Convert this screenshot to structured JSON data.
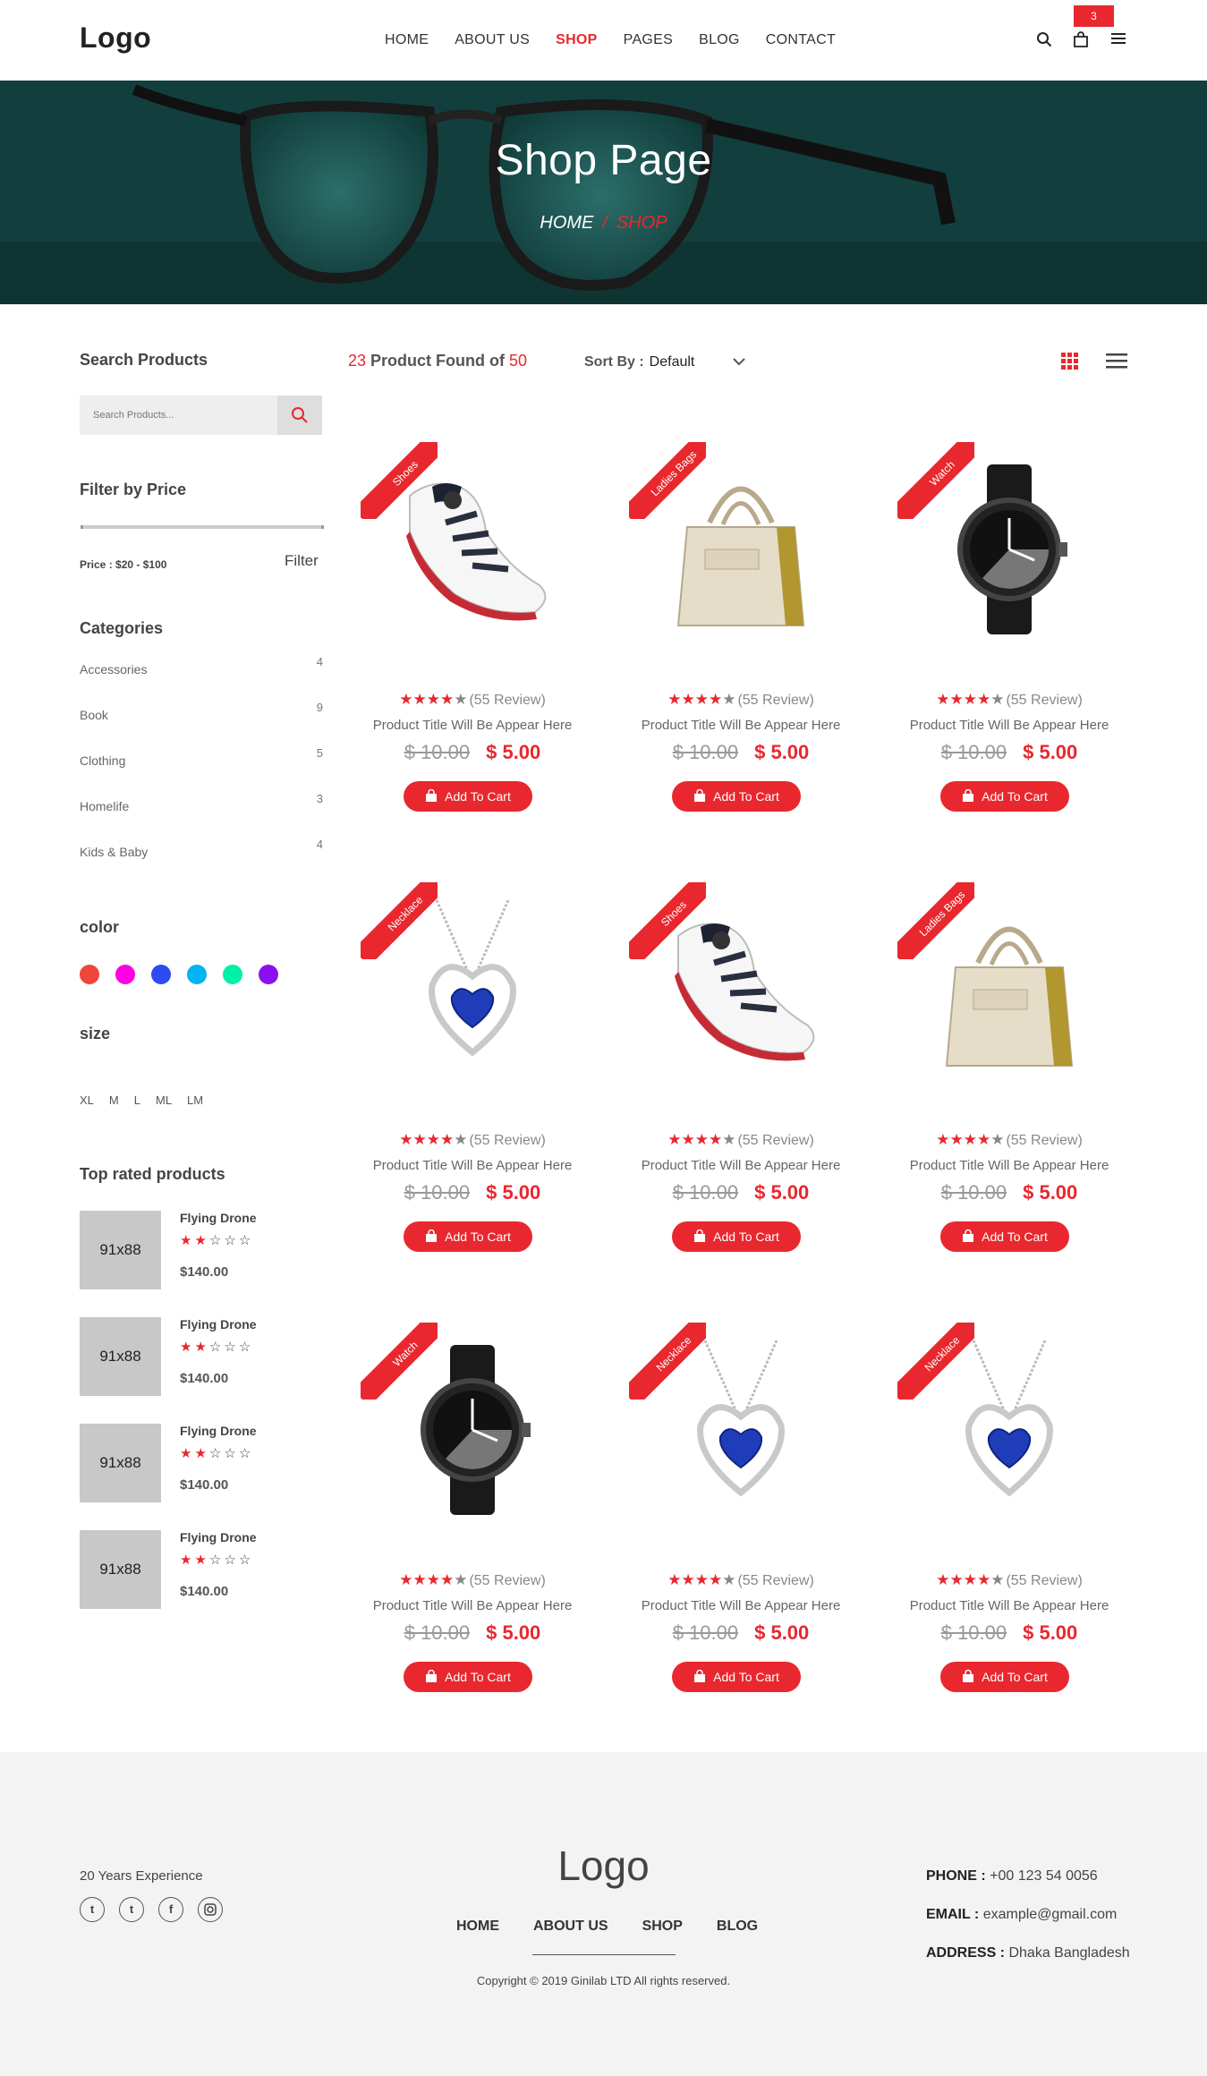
{
  "header": {
    "logo": "Logo",
    "nav": [
      {
        "label": "HOME"
      },
      {
        "label": "ABOUT US"
      },
      {
        "label": "SHOP"
      },
      {
        "label": "PAGES"
      },
      {
        "label": "BLOG"
      },
      {
        "label": "CONTACT"
      }
    ],
    "cart_count": "3"
  },
  "hero": {
    "title": "Shop Page",
    "crumb_home": "HOME",
    "crumb_sep": "/",
    "crumb_current": "SHOP"
  },
  "sidebar": {
    "search_heading": "Search Products",
    "search_placeholder": "Search Products...",
    "price_heading": "Filter by Price",
    "price_label": "Price :",
    "price_range": "$20 - $100",
    "filter_label": "Filter",
    "categories_heading": "Categories",
    "categories": [
      {
        "name": "Accessories",
        "count": "4"
      },
      {
        "name": "Book",
        "count": "9"
      },
      {
        "name": "Clothing",
        "count": "5"
      },
      {
        "name": "Homelife",
        "count": "3"
      },
      {
        "name": "Kids & Baby",
        "count": "4"
      }
    ],
    "color_heading": "color",
    "colors": [
      "#f0453a",
      "#ff00e1",
      "#2a4cf0",
      "#00b4f0",
      "#00f0a8",
      "#8a10f0"
    ],
    "size_heading": "size",
    "sizes": [
      "XL",
      "M",
      "L",
      "ML",
      "LM"
    ],
    "top_heading": "Top rated products",
    "top_rated": [
      {
        "thumb": "91x88",
        "name": "Flying Drone",
        "rating": 2,
        "price": "$140.00"
      },
      {
        "thumb": "91x88",
        "name": "Flying Drone",
        "rating": 2,
        "price": "$140.00"
      },
      {
        "thumb": "91x88",
        "name": "Flying Drone",
        "rating": 2,
        "price": "$140.00"
      },
      {
        "thumb": "91x88",
        "name": "Flying Drone",
        "rating": 2,
        "price": "$140.00"
      }
    ]
  },
  "toolbar": {
    "found_count": "23",
    "found_text": " Product Found of ",
    "found_total": "50",
    "sort_label": "Sort By :",
    "sort_value": "Default"
  },
  "products": [
    {
      "tag": "Shoes",
      "image": "shoe-icon",
      "rating": 4,
      "reviews": "(55 Review)",
      "title": "Product Title Will Be Appear Here",
      "old_price": "$ 10.00",
      "price": "$ 5.00",
      "cart_label": "Add To Cart"
    },
    {
      "tag": "Ladies Bags",
      "image": "bag-icon",
      "rating": 4,
      "reviews": "(55 Review)",
      "title": "Product Title Will Be Appear Here",
      "old_price": "$ 10.00",
      "price": "$ 5.00",
      "cart_label": "Add To Cart"
    },
    {
      "tag": "Watch",
      "image": "watch-icon",
      "rating": 4,
      "reviews": "(55 Review)",
      "title": "Product Title Will Be Appear Here",
      "old_price": "$ 10.00",
      "price": "$ 5.00",
      "cart_label": "Add To Cart"
    },
    {
      "tag": "Necklace",
      "image": "necklace-icon",
      "rating": 4,
      "reviews": "(55 Review)",
      "title": "Product Title Will Be Appear Here",
      "old_price": "$ 10.00",
      "price": "$ 5.00",
      "cart_label": "Add To Cart"
    },
    {
      "tag": "Shoes",
      "image": "shoe-icon",
      "rating": 4,
      "reviews": "(55 Review)",
      "title": "Product Title Will Be Appear Here",
      "old_price": "$ 10.00",
      "price": "$ 5.00",
      "cart_label": "Add To Cart"
    },
    {
      "tag": "Ladies Bags",
      "image": "bag-icon",
      "rating": 4,
      "reviews": "(55 Review)",
      "title": "Product Title Will Be Appear Here",
      "old_price": "$ 10.00",
      "price": "$ 5.00",
      "cart_label": "Add To Cart"
    },
    {
      "tag": "Watch",
      "image": "watch-icon",
      "rating": 4,
      "reviews": "(55 Review)",
      "title": "Product Title Will Be Appear Here",
      "old_price": "$ 10.00",
      "price": "$ 5.00",
      "cart_label": "Add To Cart"
    },
    {
      "tag": "Necklace",
      "image": "necklace-icon",
      "rating": 4,
      "reviews": "(55 Review)",
      "title": "Product Title Will Be Appear Here",
      "old_price": "$ 10.00",
      "price": "$ 5.00",
      "cart_label": "Add To Cart"
    },
    {
      "tag": "Necklace",
      "image": "necklace-icon",
      "rating": 4,
      "reviews": "(55 Review)",
      "title": "Product Title Will Be Appear Here",
      "old_price": "$ 10.00",
      "price": "$ 5.00",
      "cart_label": "Add To Cart"
    }
  ],
  "footer": {
    "experience": "20 Years Experience",
    "social": [
      "twitter-icon",
      "tumblr-icon",
      "facebook-icon",
      "instagram-icon"
    ],
    "logo": "Logo",
    "nav": [
      "HOME",
      "ABOUT US",
      "SHOP",
      "BLOG"
    ],
    "copyright": "Copyright © 2019 Ginilab LTD All rights reserved.",
    "phone_label": "PHONE :",
    "phone": " +00 123 54 0056",
    "email_label": "EMAIL :",
    "email": " example@gmail.com",
    "address_label": "ADDRESS :",
    "address": " Dhaka Bangladesh"
  },
  "accent": "#e8282e"
}
